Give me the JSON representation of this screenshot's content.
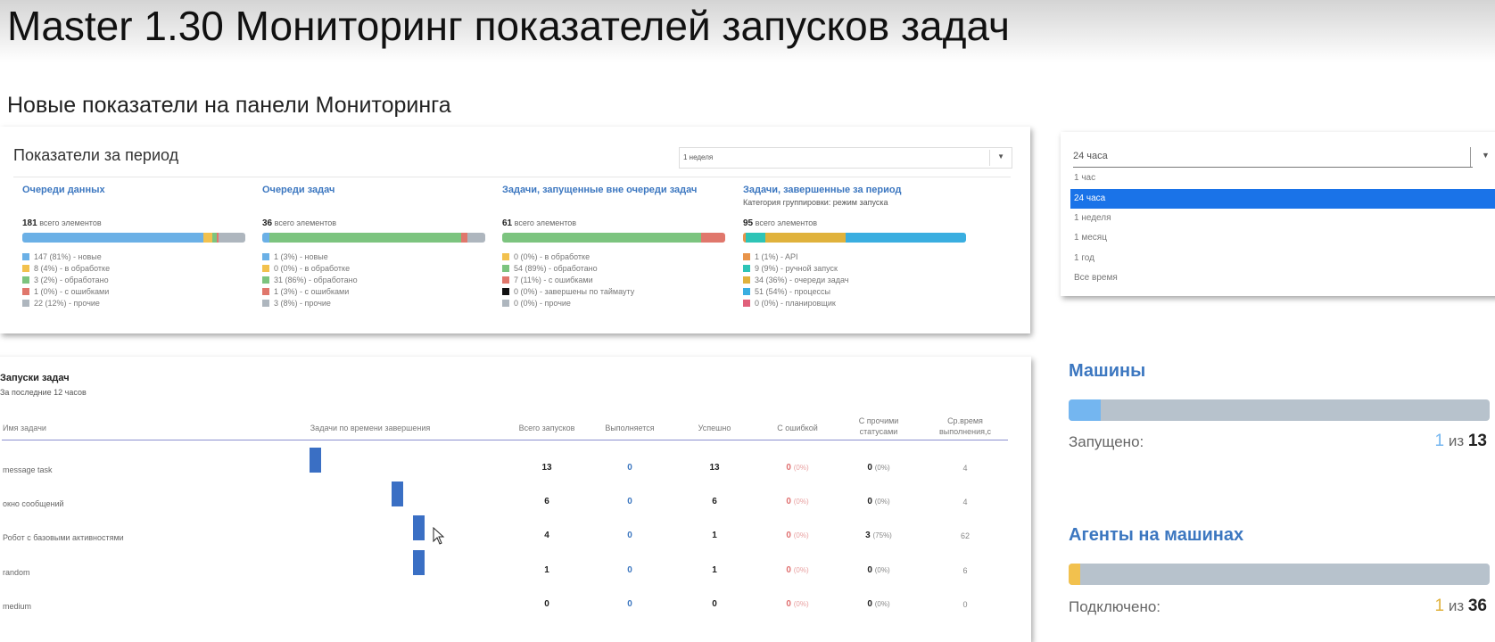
{
  "slide": {
    "title": "Master 1.30 Мониторинг показателей запусков задач",
    "subtitle": "Новые показатели на панели Мониторинга"
  },
  "period_panel": {
    "title": "Показатели за период",
    "select_value": "1 неделя",
    "columns": [
      {
        "title": "Очереди данных",
        "sub": "",
        "total": "181",
        "total_label": "всего элементов",
        "segments": [
          {
            "pct": 0.81,
            "color": "#6bb0e6"
          },
          {
            "pct": 0.04,
            "color": "#f2c14e"
          },
          {
            "pct": 0.02,
            "color": "#7cc47f"
          },
          {
            "pct": 0.01,
            "color": "#e0776c"
          },
          {
            "pct": 0.12,
            "color": "#aeb6be"
          }
        ],
        "legend": [
          {
            "text": "147 (81%) - новые",
            "color": "#6bb0e6"
          },
          {
            "text": "8 (4%) - в обработке",
            "color": "#f2c14e"
          },
          {
            "text": "3 (2%) - обработано",
            "color": "#7cc47f"
          },
          {
            "text": "1 (0%) - с ошибками",
            "color": "#e0776c"
          },
          {
            "text": "22 (12%) - прочие",
            "color": "#aeb6be"
          }
        ]
      },
      {
        "title": "Очереди задач",
        "sub": "",
        "total": "36",
        "total_label": "всего элементов",
        "segments": [
          {
            "pct": 0.03,
            "color": "#6bb0e6"
          },
          {
            "pct": 0.86,
            "color": "#7cc47f"
          },
          {
            "pct": 0.03,
            "color": "#e0776c"
          },
          {
            "pct": 0.08,
            "color": "#aeb6be"
          }
        ],
        "legend": [
          {
            "text": "1 (3%) - новые",
            "color": "#6bb0e6"
          },
          {
            "text": "0 (0%) - в обработке",
            "color": "#f2c14e"
          },
          {
            "text": "31 (86%) - обработано",
            "color": "#7cc47f"
          },
          {
            "text": "1 (3%) - с ошибками",
            "color": "#e0776c"
          },
          {
            "text": "3 (8%) - прочие",
            "color": "#aeb6be"
          }
        ]
      },
      {
        "title": "Задачи, запущенные вне очереди задач",
        "sub": "",
        "total": "61",
        "total_label": "всего элементов",
        "segments": [
          {
            "pct": 0.89,
            "color": "#7cc47f"
          },
          {
            "pct": 0.11,
            "color": "#e0776c"
          }
        ],
        "legend": [
          {
            "text": "0 (0%) - в обработке",
            "color": "#f2c14e"
          },
          {
            "text": "54 (89%) - обработано",
            "color": "#7cc47f"
          },
          {
            "text": "7 (11%) - с ошибками",
            "color": "#e0776c"
          },
          {
            "text": "0 (0%) - завершены по таймауту",
            "color": "#111111"
          },
          {
            "text": "0 (0%) - прочие",
            "color": "#aeb6be"
          }
        ]
      },
      {
        "title": "Задачи, завершенные за период",
        "sub": "Категория группировки: режим запуска",
        "total": "95",
        "total_label": "всего элементов",
        "segments": [
          {
            "pct": 0.01,
            "color": "#e8944a"
          },
          {
            "pct": 0.09,
            "color": "#2ec4b6"
          },
          {
            "pct": 0.36,
            "color": "#e0b23c"
          },
          {
            "pct": 0.54,
            "color": "#3aaee0"
          }
        ],
        "legend": [
          {
            "text": "1 (1%) - API",
            "color": "#e8944a"
          },
          {
            "text": "9 (9%) - ручной запуск",
            "color": "#2ec4b6"
          },
          {
            "text": "34 (36%) - очереди задач",
            "color": "#e0b23c"
          },
          {
            "text": "51 (54%) - процессы",
            "color": "#3aaee0"
          },
          {
            "text": "0 (0%) - планировщик",
            "color": "#e0607a"
          }
        ]
      }
    ]
  },
  "period_dropdown": {
    "current": "24 часа",
    "options": [
      "1 час",
      "24 часа",
      "1 неделя",
      "1 месяц",
      "1 год",
      "Все время"
    ],
    "selected_index": 1
  },
  "task_runs": {
    "title": "Запуски задач",
    "subtitle": "За последние 12 часов",
    "headers": {
      "name": "Имя задачи",
      "by_time": "Задачи по времени завершения",
      "total": "Всего запусков",
      "running": "Выполняется",
      "success": "Успешно",
      "error": "С ошибкой",
      "other": "С прочими статусами",
      "avg": "Ср.время выполнения,с"
    },
    "rows": [
      {
        "name": "message task",
        "total": "13",
        "running": "0",
        "success": "13",
        "error": "0",
        "error_pct": "(0%)",
        "other": "0",
        "other_pct": "(0%)",
        "avg": "4",
        "bar_pos": 0.1
      },
      {
        "name": "окно сообщений",
        "total": "6",
        "running": "0",
        "success": "6",
        "error": "0",
        "error_pct": "(0%)",
        "other": "0",
        "other_pct": "(0%)",
        "avg": "4",
        "bar_pos": 0.64
      },
      {
        "name": "Робот с базовыми активностями",
        "total": "4",
        "running": "0",
        "success": "1",
        "error": "0",
        "error_pct": "(0%)",
        "other": "3",
        "other_pct": "(75%)",
        "avg": "62",
        "bar_pos": 0.78
      },
      {
        "name": "random",
        "total": "1",
        "running": "0",
        "success": "1",
        "error": "0",
        "error_pct": "(0%)",
        "other": "0",
        "other_pct": "(0%)",
        "avg": "6",
        "bar_pos": 0.78
      },
      {
        "name": "medium",
        "total": "0",
        "running": "0",
        "success": "0",
        "error": "0",
        "error_pct": "(0%)",
        "other": "0",
        "other_pct": "(0%)",
        "avg": "0",
        "bar_pos": null
      }
    ]
  },
  "machines": {
    "title": "Машины",
    "label": "Запущено:",
    "value": "1",
    "of": "из",
    "total": "13",
    "fill_fraction": 0.077,
    "fill_color": "#74b6f0"
  },
  "agents": {
    "title": "Агенты на машинах",
    "label": "Подключено:",
    "value": "1",
    "of": "из",
    "total": "36",
    "fill_fraction": 0.028,
    "fill_color": "#f2c14e"
  }
}
